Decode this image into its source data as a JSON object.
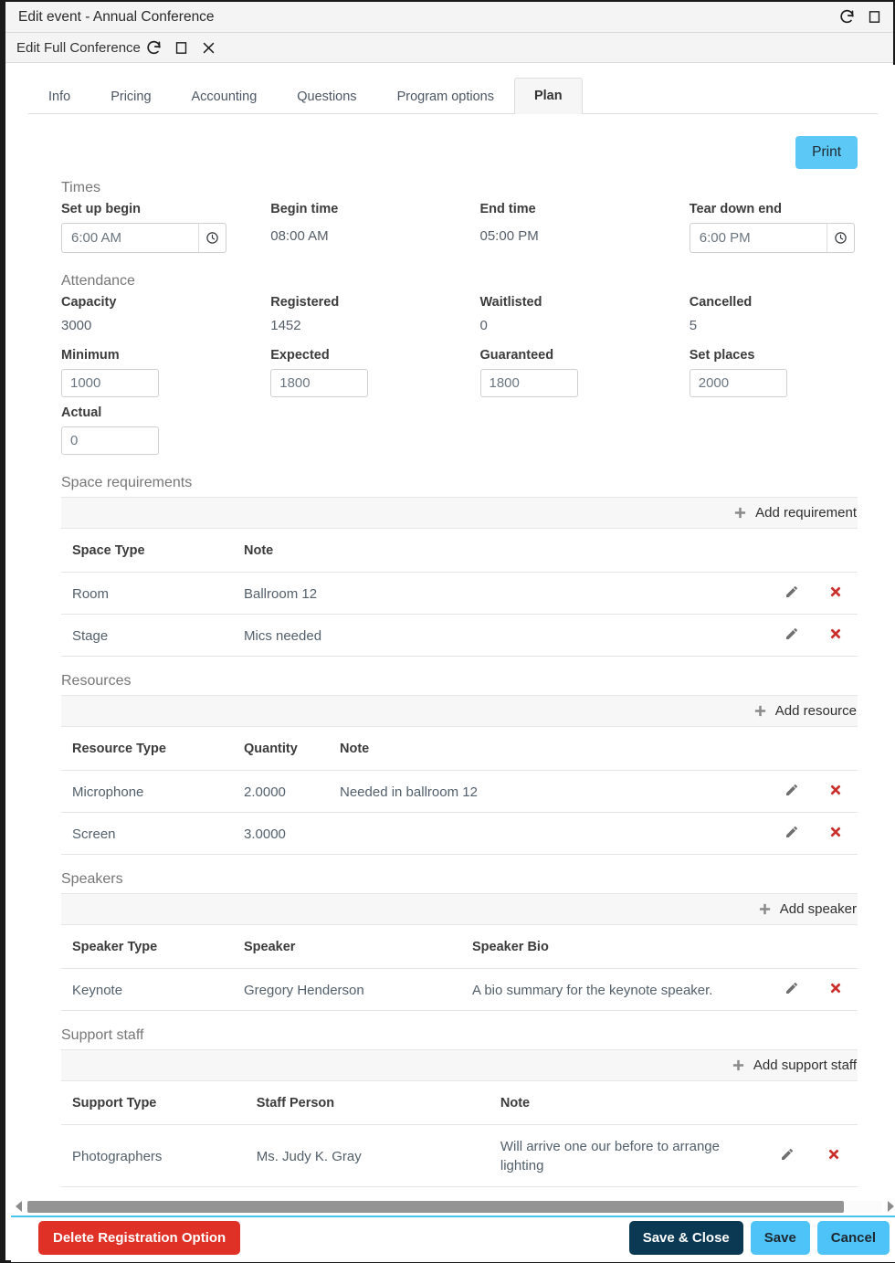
{
  "window": {
    "outer_title": "Edit event - Annual Conference",
    "inner_title": "Edit Full Conference",
    "icons": {
      "refresh": "refresh-icon",
      "maximize": "maximize-icon",
      "close": "close-icon"
    }
  },
  "tabs": [
    {
      "label": "Info",
      "active": false
    },
    {
      "label": "Pricing",
      "active": false
    },
    {
      "label": "Accounting",
      "active": false
    },
    {
      "label": "Questions",
      "active": false
    },
    {
      "label": "Program options",
      "active": false
    },
    {
      "label": "Plan",
      "active": true
    }
  ],
  "toolbar": {
    "print_label": "Print"
  },
  "times": {
    "title": "Times",
    "setup_begin": {
      "label": "Set up begin",
      "value": "6:00 AM",
      "icon": "clock-icon"
    },
    "begin_time": {
      "label": "Begin time",
      "value": "08:00 AM"
    },
    "end_time": {
      "label": "End time",
      "value": "05:00 PM"
    },
    "tear_down_end": {
      "label": "Tear down end",
      "value": "6:00 PM",
      "icon": "clock-icon"
    }
  },
  "attendance": {
    "title": "Attendance",
    "capacity": {
      "label": "Capacity",
      "value": "3000"
    },
    "registered": {
      "label": "Registered",
      "value": "1452"
    },
    "waitlisted": {
      "label": "Waitlisted",
      "value": "0"
    },
    "cancelled": {
      "label": "Cancelled",
      "value": "5"
    },
    "minimum": {
      "label": "Minimum",
      "value": "1000"
    },
    "expected": {
      "label": "Expected",
      "value": "1800"
    },
    "guaranteed": {
      "label": "Guaranteed",
      "value": "1800"
    },
    "set_places": {
      "label": "Set places",
      "value": "2000"
    },
    "actual": {
      "label": "Actual",
      "value": "0"
    }
  },
  "space_requirements": {
    "title": "Space requirements",
    "add_label": "Add requirement",
    "columns": [
      "Space Type",
      "Note"
    ],
    "rows": [
      {
        "space_type": "Room",
        "note": "Ballroom 12"
      },
      {
        "space_type": "Stage",
        "note": "Mics needed"
      }
    ]
  },
  "resources": {
    "title": "Resources",
    "add_label": "Add resource",
    "columns": [
      "Resource Type",
      "Quantity",
      "Note"
    ],
    "rows": [
      {
        "resource_type": "Microphone",
        "quantity": "2.0000",
        "note": "Needed in ballroom 12"
      },
      {
        "resource_type": "Screen",
        "quantity": "3.0000",
        "note": ""
      }
    ]
  },
  "speakers": {
    "title": "Speakers",
    "add_label": "Add speaker",
    "columns": [
      "Speaker Type",
      "Speaker",
      "Speaker Bio"
    ],
    "rows": [
      {
        "speaker_type": "Keynote",
        "speaker": "Gregory Henderson",
        "bio": "A bio summary for the keynote speaker."
      }
    ]
  },
  "support_staff": {
    "title": "Support staff",
    "add_label": "Add support staff",
    "columns": [
      "Support Type",
      "Staff Person",
      "Note"
    ],
    "rows": [
      {
        "support_type": "Photographers",
        "staff_person": "Ms. Judy K. Gray",
        "note": "Will arrive one our before to arrange lighting"
      }
    ]
  },
  "footer": {
    "delete_label": "Delete Registration Option",
    "save_close_label": "Save & Close",
    "save_label": "Save",
    "cancel_label": "Cancel"
  },
  "colors": {
    "accent": "#5bc8f5",
    "danger": "#e03127",
    "dark": "#0b3954",
    "delete_icon": "#c9302c"
  }
}
